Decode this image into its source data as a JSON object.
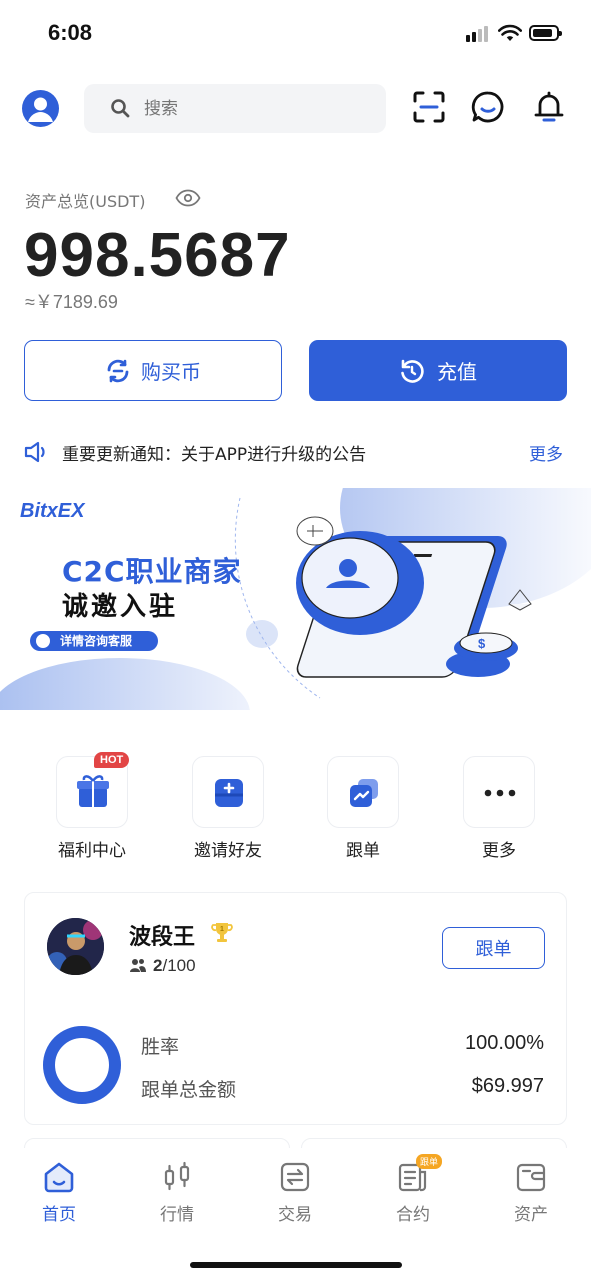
{
  "status_bar": {
    "time": "6:08"
  },
  "header": {
    "search_placeholder": "搜索",
    "icons": [
      "avatar-icon",
      "scan-icon",
      "chat-icon",
      "bell-icon"
    ]
  },
  "assets": {
    "label": "资产总览(USDT)",
    "value": "998.5687",
    "cny": "≈￥7189.69"
  },
  "actions": {
    "buy_label": "购买币",
    "deposit_label": "充值"
  },
  "notice": {
    "text": "重要更新通知：关于APP进行升级的公告",
    "more": "更多"
  },
  "banner": {
    "brand": "BitxEX",
    "headline": "C2C职业商家",
    "subheadline": "诚邀入驻",
    "cta": "详情咨询客服"
  },
  "quick_menu": [
    {
      "label": "福利中心",
      "icon": "gift-icon",
      "badge": "HOT"
    },
    {
      "label": "邀请好友",
      "icon": "invite-icon"
    },
    {
      "label": "跟单",
      "icon": "copy-trade-icon"
    },
    {
      "label": "更多",
      "icon": "more-dots-icon"
    }
  ],
  "trader": {
    "name": "波段王",
    "followers_current": "2",
    "followers_max": "/100",
    "follow_label": "跟单",
    "win_rate_label": "胜率",
    "win_rate_value": "100.00%",
    "total_label": "跟单总金额",
    "total_value": "$69.997",
    "win_rate_fraction": 1.0
  },
  "tabs": [
    {
      "label": "首页",
      "icon": "home-icon",
      "active": true
    },
    {
      "label": "行情",
      "icon": "candles-icon"
    },
    {
      "label": "交易",
      "icon": "trade-icon"
    },
    {
      "label": "合约",
      "icon": "contract-icon",
      "badge": "跟单"
    },
    {
      "label": "资产",
      "icon": "wallet-icon"
    }
  ],
  "colors": {
    "accent": "#2f5fd8",
    "hot": "#e24545",
    "badge": "#f5a623"
  }
}
